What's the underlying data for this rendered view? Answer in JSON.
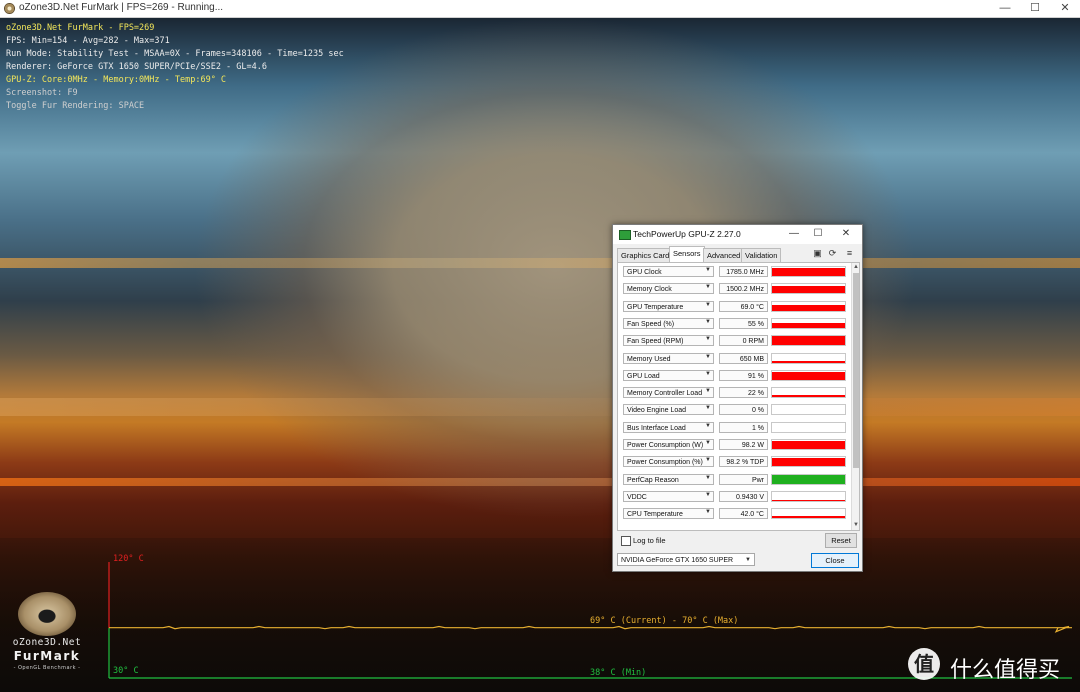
{
  "furmark_window": {
    "title": "oZone3D.Net FurMark | FPS=269 - Running...",
    "controls": {
      "minimize": "—",
      "maximize": "☐",
      "close": "✕"
    }
  },
  "hud": {
    "line1": "oZone3D.Net FurMark - FPS=269",
    "line2": "FPS: Min=154 - Avg=282 - Max=371",
    "line3": "Run Mode: Stability Test - MSAA=0X - Frames=348106 - Time=1235 sec",
    "line4": "Renderer: GeForce GTX 1650 SUPER/PCIe/SSE2 - GL=4.6",
    "line5": "GPU-Z: Core:0MHz - Memory:0MHz - Temp:69° C",
    "line6": "Screenshot: F9",
    "line7": "Toggle Fur Rendering: SPACE"
  },
  "temp_graph": {
    "max_label": "120° C",
    "min_label": "30° C",
    "current_label": "69° C (Current) - 70° C (Max)",
    "min_reading_label": "38° C (Min)",
    "axis_max": 120,
    "axis_min": 30,
    "current_temp": 69,
    "colors": {
      "axis_red": "#e02020",
      "axis_green": "#20c040",
      "line": "#e8b030"
    }
  },
  "logo": {
    "line1": "oZone3D.Net",
    "line2": "FurMark",
    "line3": "- OpenGL Benchmark -"
  },
  "watermark": {
    "symbol": "值",
    "text": "什么值得买"
  },
  "gpuz": {
    "title": "TechPowerUp GPU-Z 2.27.0",
    "controls": {
      "minimize": "—",
      "maximize": "☐",
      "close": "✕"
    },
    "tabs": [
      "Graphics Card",
      "Sensors",
      "Advanced",
      "Validation"
    ],
    "active_tab": "Sensors",
    "toolbar_icons": [
      "camera-icon",
      "refresh-icon",
      "menu-icon"
    ],
    "sensors": [
      {
        "name": "GPU Clock",
        "value": "1785.0 MHz",
        "color": "#ff0000",
        "level": 0.85
      },
      {
        "name": "Memory Clock",
        "value": "1500.2 MHz",
        "color": "#ff0000",
        "level": 0.85
      },
      {
        "name": "GPU Temperature",
        "value": "69.0 °C",
        "color": "#ff0000",
        "level": 0.6
      },
      {
        "name": "Fan Speed (%)",
        "value": "55 %",
        "color": "#ff0000",
        "level": 0.55
      },
      {
        "name": "Fan Speed (RPM)",
        "value": "0 RPM",
        "color": "#ff0000",
        "level": 1.0
      },
      {
        "name": "Memory Used",
        "value": "650 MB",
        "color": "#ff0000",
        "level": 0.12
      },
      {
        "name": "GPU Load",
        "value": "91 %",
        "color": "#ff0000",
        "level": 0.91
      },
      {
        "name": "Memory Controller Load",
        "value": "22 %",
        "color": "#ff0000",
        "level": 0.22
      },
      {
        "name": "Video Engine Load",
        "value": "0 %",
        "color": "#ff0000",
        "level": 0.0
      },
      {
        "name": "Bus Interface Load",
        "value": "1 %",
        "color": "#ff0000",
        "level": 0.02
      },
      {
        "name": "Power Consumption (W)",
        "value": "98.2 W",
        "color": "#ff0000",
        "level": 0.9
      },
      {
        "name": "Power Consumption (%)",
        "value": "98.2 % TDP",
        "color": "#ff0000",
        "level": 0.95
      },
      {
        "name": "PerfCap Reason",
        "value": "Pwr",
        "color": "#1fb01f",
        "level": 1.0
      },
      {
        "name": "VDDC",
        "value": "0.9430 V",
        "color": "#ff0000",
        "level": 0.05
      },
      {
        "name": "CPU Temperature",
        "value": "42.0 °C",
        "color": "#ff0000",
        "level": 0.3
      }
    ],
    "log_label": "Log to file",
    "reset_label": "Reset",
    "device": "NVIDIA GeForce GTX 1650 SUPER",
    "close_label": "Close"
  }
}
